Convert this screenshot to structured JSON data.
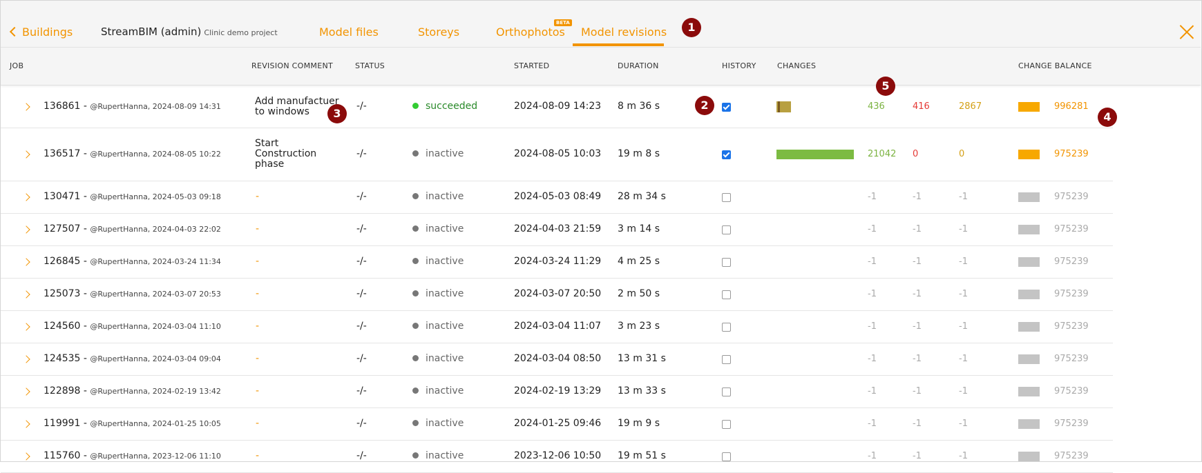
{
  "nav": {
    "back_label": "Buildings",
    "project_name": "StreamBIM (admin)",
    "project_sub": "Clinic demo project",
    "tabs": [
      {
        "label": "Model files"
      },
      {
        "label": "Storeys"
      },
      {
        "label": "Orthophotos"
      },
      {
        "label": "Model revisions"
      }
    ],
    "beta_badge": "BETA"
  },
  "markers": [
    "1",
    "2",
    "3",
    "4",
    "5"
  ],
  "columns": {
    "job": "JOB",
    "comment": "REVISION COMMENT",
    "status": "STATUS",
    "started": "STARTED",
    "duration": "DURATION",
    "history": "HISTORY",
    "changes": "CHANGES",
    "balance": "CHANGE BALANCE"
  },
  "rows": [
    {
      "job": "136861",
      "meta": "@RupertHanna, 2024-08-09 14:31",
      "comment": "Add manufactuer to windows",
      "comment_lines": [
        "Add manufactuer",
        "to windows"
      ],
      "ratio": "-/-",
      "status": "succeeded",
      "started": "2024-08-09 14:23",
      "duration": "8 m 36 s",
      "history": true,
      "added": "436",
      "removed": "416",
      "changed": "2867",
      "balance": "996281"
    },
    {
      "job": "136517",
      "meta": "@RupertHanna, 2024-08-05 10:22",
      "comment": "Start Construction phase",
      "comment_lines": [
        "Start",
        "Construction",
        "phase"
      ],
      "ratio": "-/-",
      "status": "inactive",
      "started": "2024-08-05 10:03",
      "duration": "19 m 8 s",
      "history": true,
      "added": "21042",
      "removed": "0",
      "changed": "0",
      "balance": "975239"
    },
    {
      "job": "130471",
      "meta": "@RupertHanna, 2024-05-03 09:18",
      "comment": "-",
      "ratio": "-/-",
      "status": "inactive",
      "started": "2024-05-03 08:49",
      "duration": "28 m 34 s",
      "history": false,
      "added": "-1",
      "removed": "-1",
      "changed": "-1",
      "balance": "975239"
    },
    {
      "job": "127507",
      "meta": "@RupertHanna, 2024-04-03 22:02",
      "comment": "-",
      "ratio": "-/-",
      "status": "inactive",
      "started": "2024-04-03 21:59",
      "duration": "3 m 14 s",
      "history": false,
      "added": "-1",
      "removed": "-1",
      "changed": "-1",
      "balance": "975239"
    },
    {
      "job": "126845",
      "meta": "@RupertHanna, 2024-03-24 11:34",
      "comment": "-",
      "ratio": "-/-",
      "status": "inactive",
      "started": "2024-03-24 11:29",
      "duration": "4 m 25 s",
      "history": false,
      "added": "-1",
      "removed": "-1",
      "changed": "-1",
      "balance": "975239"
    },
    {
      "job": "125073",
      "meta": "@RupertHanna, 2024-03-07 20:53",
      "comment": "-",
      "ratio": "-/-",
      "status": "inactive",
      "started": "2024-03-07 20:50",
      "duration": "2 m 50 s",
      "history": false,
      "added": "-1",
      "removed": "-1",
      "changed": "-1",
      "balance": "975239"
    },
    {
      "job": "124560",
      "meta": "@RupertHanna, 2024-03-04 11:10",
      "comment": "-",
      "ratio": "-/-",
      "status": "inactive",
      "started": "2024-03-04 11:07",
      "duration": "3 m 23 s",
      "history": false,
      "added": "-1",
      "removed": "-1",
      "changed": "-1",
      "balance": "975239"
    },
    {
      "job": "124535",
      "meta": "@RupertHanna, 2024-03-04 09:04",
      "comment": "-",
      "ratio": "-/-",
      "status": "inactive",
      "started": "2024-03-04 08:50",
      "duration": "13 m 31 s",
      "history": false,
      "added": "-1",
      "removed": "-1",
      "changed": "-1",
      "balance": "975239"
    },
    {
      "job": "122898",
      "meta": "@RupertHanna, 2024-02-19 13:42",
      "comment": "-",
      "ratio": "-/-",
      "status": "inactive",
      "started": "2024-02-19 13:29",
      "duration": "13 m 33 s",
      "history": false,
      "added": "-1",
      "removed": "-1",
      "changed": "-1",
      "balance": "975239"
    },
    {
      "job": "119991",
      "meta": "@RupertHanna, 2024-01-25 10:05",
      "comment": "-",
      "ratio": "-/-",
      "status": "inactive",
      "started": "2024-01-25 09:46",
      "duration": "19 m 9 s",
      "history": false,
      "added": "-1",
      "removed": "-1",
      "changed": "-1",
      "balance": "975239"
    },
    {
      "job": "115760",
      "meta": "@RupertHanna, 2023-12-06 11:10",
      "comment": "-",
      "ratio": "-/-",
      "status": "inactive",
      "started": "2023-12-06 10:50",
      "duration": "19 m 51 s",
      "history": false,
      "added": "-1",
      "removed": "-1",
      "changed": "-1",
      "balance": "975239"
    }
  ],
  "colors": {
    "accent": "#f29400",
    "added": "#7cb342",
    "removed": "#e53935",
    "changed": "#d4a017",
    "marker": "#8b0b0b"
  }
}
